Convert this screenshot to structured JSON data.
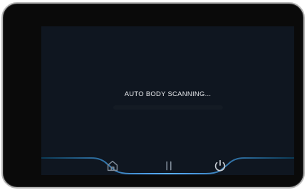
{
  "screen": {
    "status_text": "AUTO BODY SCANNING...",
    "progress": 0.0
  },
  "controls": {
    "icons": [
      "home-icon",
      "pause-icon",
      "power-icon"
    ]
  },
  "theme": {
    "bezel": "#0a0a0a",
    "screen_bg": "#0f1620",
    "accent": "#5ab0ff"
  }
}
